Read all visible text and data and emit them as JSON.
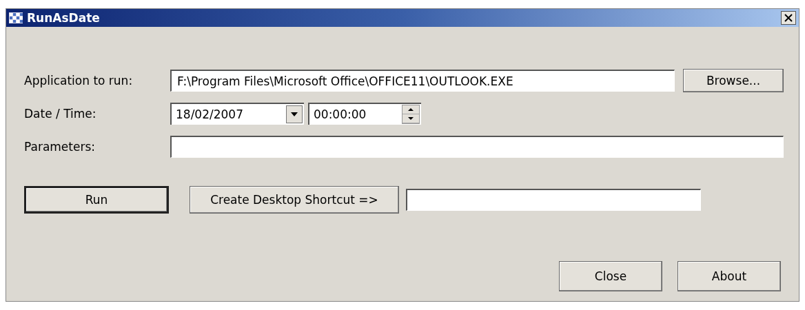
{
  "window": {
    "title": "RunAsDate"
  },
  "fields": [
    {
      "label": "Application to run:",
      "value": "F:\\Program Files\\Microsoft Office\\OFFICE11\\OUTLOOK.EXE"
    },
    {
      "label": "Parameters:"
    }
  ],
  "browse_button": "Browse...",
  "datetime": {
    "label": "Date / Time:",
    "date": "18/02/2007",
    "time": "00:00:00"
  },
  "run_button": {
    "label": "Run",
    "default": true
  },
  "shortcut_button": "Create Desktop Shortcut =>",
  "buttons": [
    "Close",
    "About"
  ]
}
